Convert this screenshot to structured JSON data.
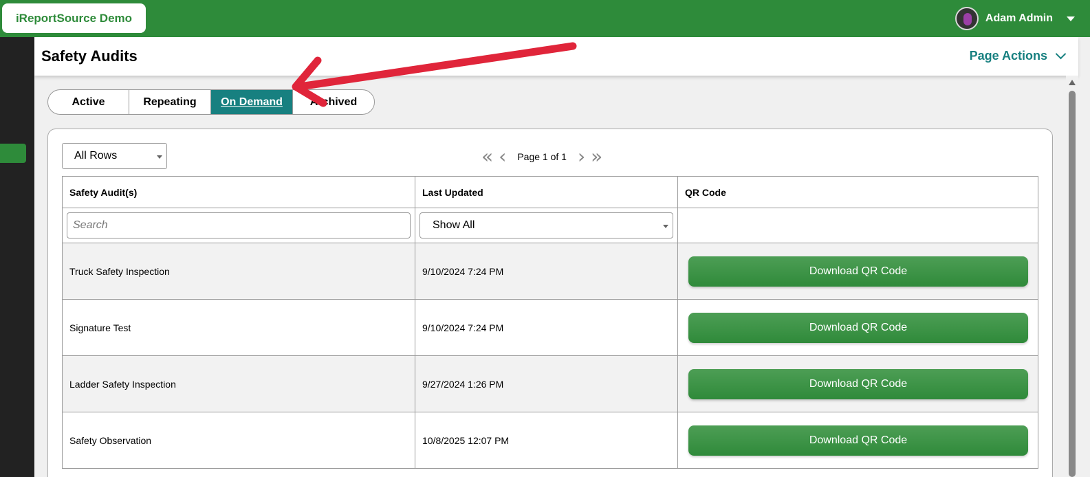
{
  "app": {
    "brand": "iReportSource Demo"
  },
  "user": {
    "name": "Adam Admin"
  },
  "page": {
    "title": "Safety Audits",
    "actions_label": "Page Actions"
  },
  "tabs": [
    {
      "label": "Active",
      "active": false
    },
    {
      "label": "Repeating",
      "active": false
    },
    {
      "label": "On Demand",
      "active": true
    },
    {
      "label": "Archived",
      "active": false
    }
  ],
  "rows_select": {
    "value": "All Rows"
  },
  "pager": {
    "text": "Page 1 of 1"
  },
  "table": {
    "headers": [
      "Safety Audit(s)",
      "Last Updated",
      "QR Code"
    ],
    "search_placeholder": "Search",
    "filter_value": "Show All",
    "rows": [
      {
        "name": "Truck Safety Inspection",
        "updated": "9/10/2024 7:24 PM",
        "action": "Download QR Code"
      },
      {
        "name": "Signature Test",
        "updated": "9/10/2024 7:24 PM",
        "action": "Download QR Code"
      },
      {
        "name": "Ladder Safety Inspection",
        "updated": "9/27/2024 1:26 PM",
        "action": "Download QR Code"
      },
      {
        "name": "Safety Observation",
        "updated": "10/8/2025 12:07 PM",
        "action": "Download QR Code"
      }
    ]
  },
  "colors": {
    "brand_green": "#2e8b3a",
    "teal": "#178080",
    "annotation_red": "#e0253a"
  }
}
